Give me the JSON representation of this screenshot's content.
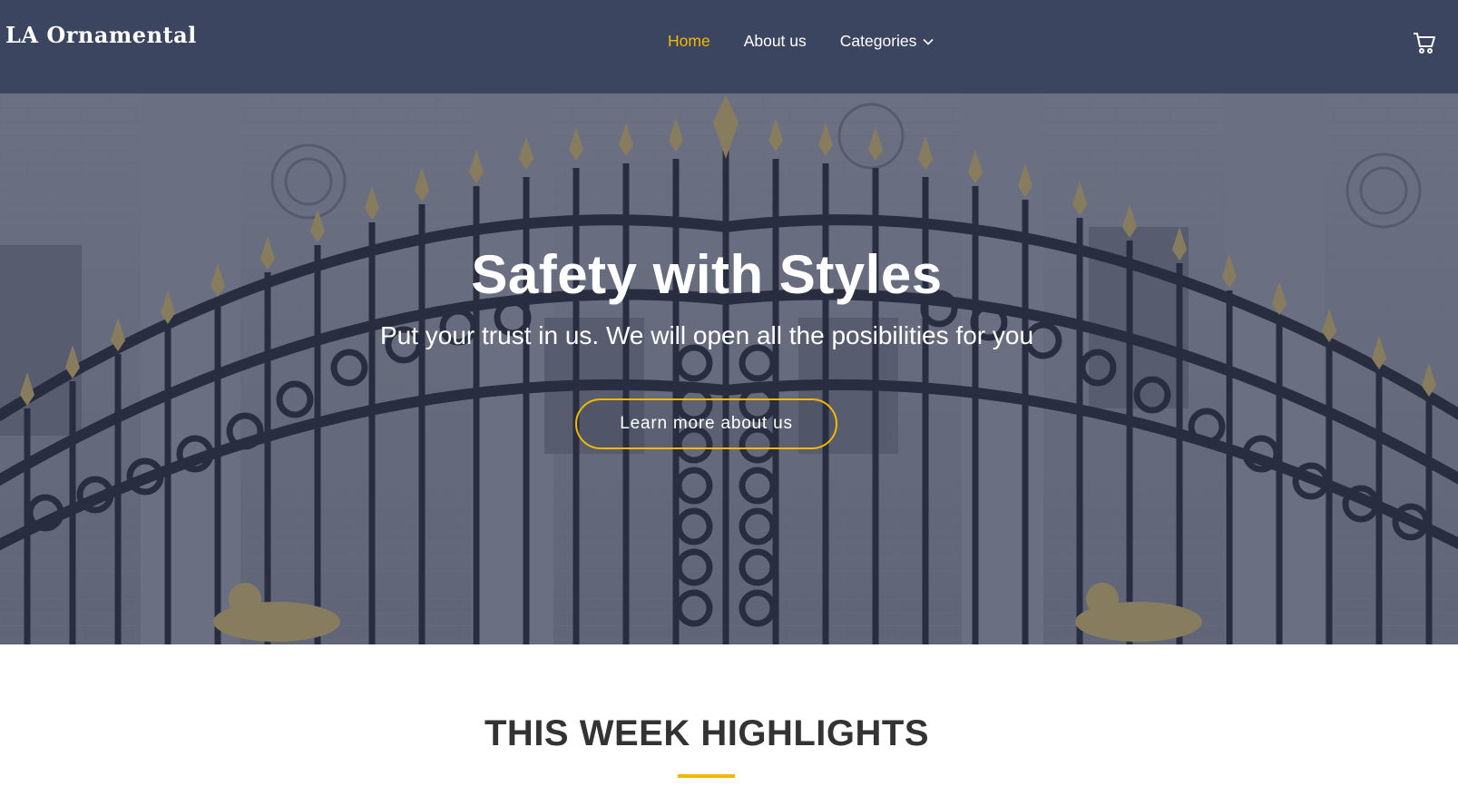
{
  "brand": {
    "logo_text": "LA Ornamental"
  },
  "nav": {
    "items": [
      {
        "label": "Home",
        "active": true
      },
      {
        "label": "About us",
        "active": false
      },
      {
        "label": "Categories",
        "active": false,
        "has_dropdown": true
      }
    ],
    "cart_icon": "cart-icon"
  },
  "hero": {
    "title": "Safety with Styles",
    "subtitle": "Put your trust in us. We will open all the posibilities for you",
    "button_label": "Learn more about us",
    "background": "ornamental-gate-photo"
  },
  "highlights": {
    "title": "THIS WEEK HIGHLIGHTS"
  },
  "colors": {
    "accent": "#f5b800",
    "navbar": "#38425c",
    "heading": "#333333",
    "text_light": "#ffffff"
  }
}
